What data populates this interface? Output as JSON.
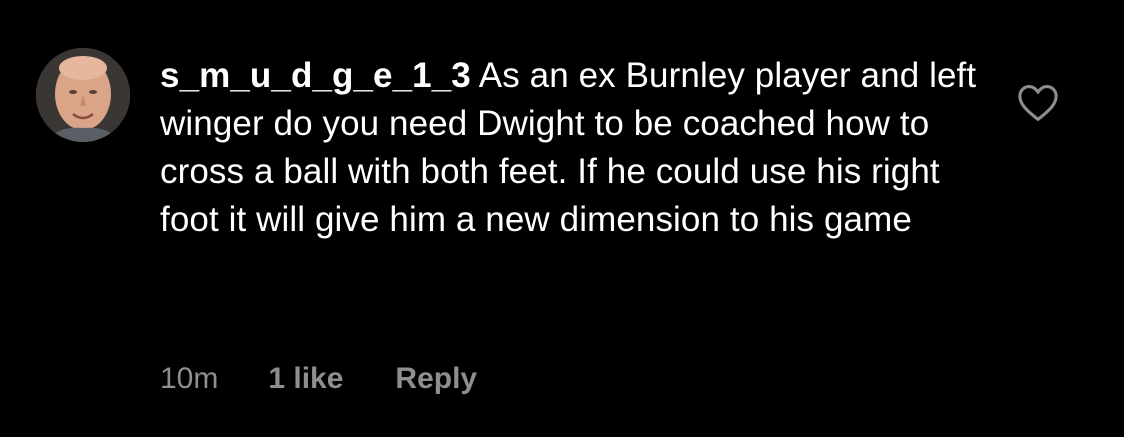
{
  "comment": {
    "username": "s_m_u_d_g_e_1_3",
    "text": "As an ex Burnley player and left winger do you need Dwight to be coached how to cross a ball with both feet. If he could use his right foot it will give him a new dimension to his game",
    "timestamp": "10m",
    "likes": "1 like",
    "reply_label": "Reply",
    "avatar_icon": "profile-photo",
    "like_icon": "heart-outline-icon"
  },
  "colors": {
    "background": "#000000",
    "text": "#ffffff",
    "meta": "#8e8e8e"
  }
}
